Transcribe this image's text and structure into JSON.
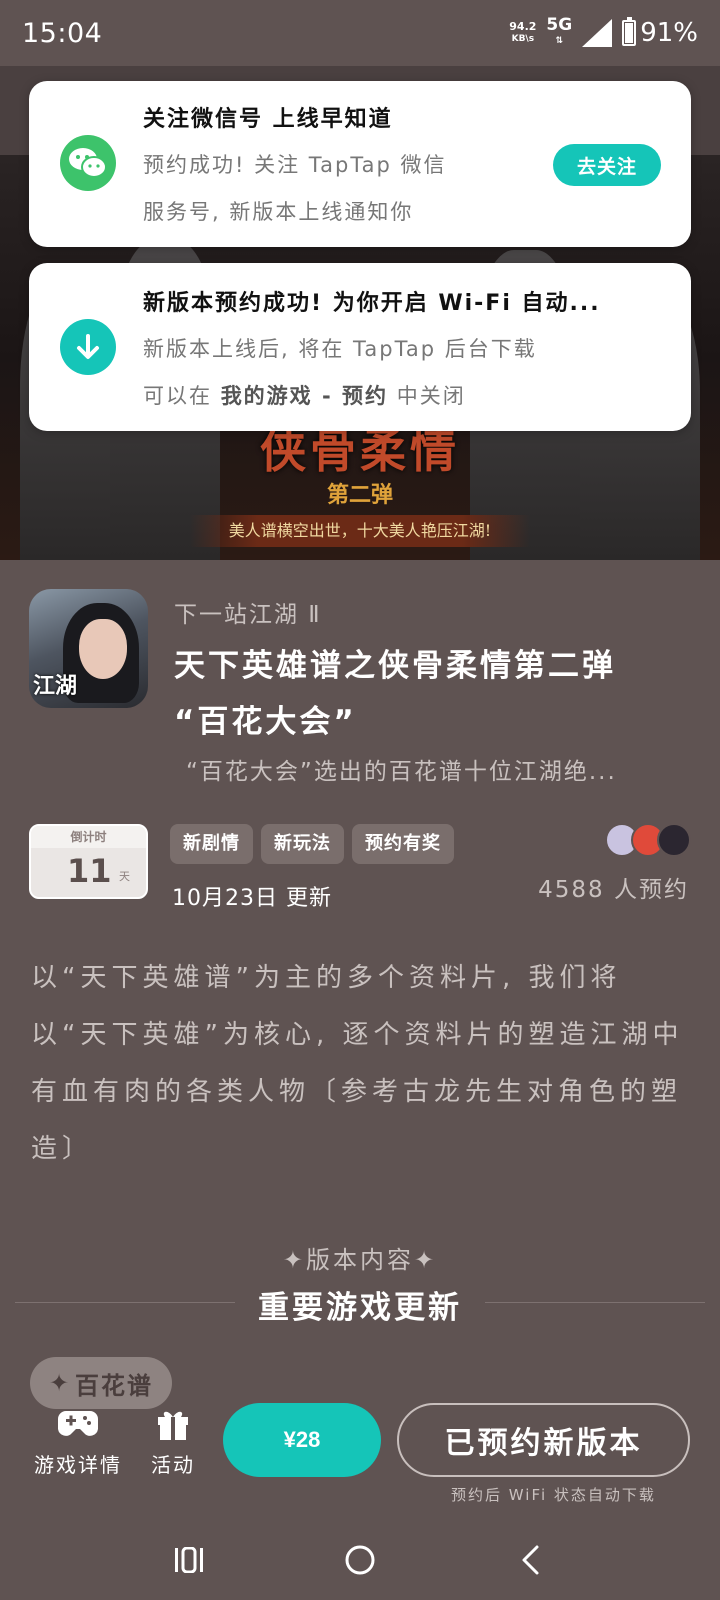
{
  "status_bar": {
    "time": "15:04",
    "net_speed_value": "94.2",
    "net_speed_unit": "KB\\s",
    "network": "5G",
    "battery": "91%",
    "battery_level": 0.91
  },
  "banner": {
    "title": "侠骨柔情",
    "subtitle": "第二弹",
    "tagline": "美人谱横空出世，十大美人艳压江湖!"
  },
  "notifications": [
    {
      "title": "关注微信号 上线早知道",
      "line1": "预约成功! 关注 TapTap 微信",
      "line2": "服务号, 新版本上线通知你",
      "button": "去关注",
      "icon": "wechat-icon"
    },
    {
      "title": "新版本预约成功! 为你开启 Wi-Fi 自动...",
      "line1": "新版本上线后, 将在 TapTap 后台下载",
      "line2_prefix": "可以在 ",
      "line2_bold": "我的游戏 - 预约",
      "line2_suffix": " 中关闭",
      "icon": "download-icon"
    }
  ],
  "game": {
    "icon_logo": "江湖",
    "name": "下一站江湖 Ⅱ",
    "update_title": "天下英雄谱之侠骨柔情第二弹 “百花大会”",
    "update_desc": "“百花大会”选出的百花谱十位江湖绝...",
    "countdown_label": "倒计时",
    "countdown_value": "11",
    "countdown_unit": "天",
    "tags": [
      "新剧情",
      "新玩法",
      "预约有奖"
    ],
    "update_date": "10月23日 更新",
    "reserve_count": "4588 人预约",
    "description": "以“天下英雄谱”为主的多个资料片, 我们将以“天下英雄”为核心, 逐个资料片的塑造江湖中有血有肉的各类人物〔参考古龙先生对角色的塑造〕"
  },
  "section": {
    "label": "✦版本内容✦",
    "heading": "重要游戏更新",
    "chip": "百花谱"
  },
  "bottom_bar": {
    "game_detail": "游戏详情",
    "activity": "活动",
    "price": "¥28",
    "reserved": "已预约新版本",
    "hint": "预约后 WiFi 状态自动下载"
  },
  "colors": {
    "background": "#5f5352",
    "accent": "#15c5b8",
    "wechat": "#3dc36b"
  }
}
